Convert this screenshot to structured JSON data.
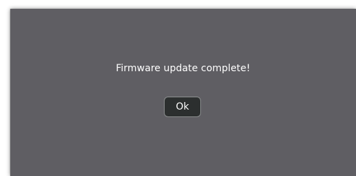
{
  "dialog": {
    "message": "Firmware update complete!",
    "ok_label": "Ok"
  },
  "colors": {
    "dialog_background": "#5f5e63",
    "button_background": "#2c2f2f",
    "button_border": "#8a8d8d",
    "text": "#ffffff"
  }
}
